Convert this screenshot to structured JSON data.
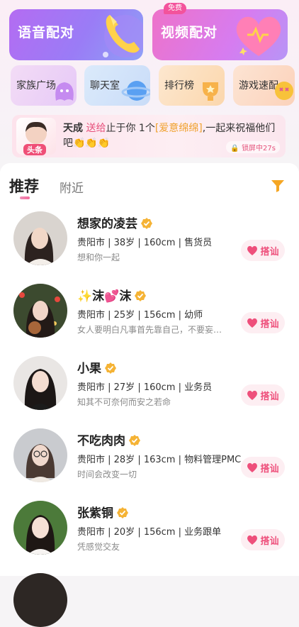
{
  "features": {
    "voice_label": "语音配对",
    "video_label": "视频配对",
    "video_badge": "免费"
  },
  "quick_links": [
    "家族广场",
    "聊天室",
    "排行榜",
    "游戏速配"
  ],
  "gift_banner": {
    "avatar_tag": "头条",
    "sender": "天成",
    "verb": "送给",
    "receiver": "止于你",
    "count": "1个",
    "gift": "[爱意绵绵]",
    "message": ",一起来祝福他们吧",
    "emoji": "👏👏👏",
    "lock_text": "锁屏中27s"
  },
  "tabs": {
    "active": "推荐",
    "inactive": "附近"
  },
  "users": [
    {
      "name": "想家的凌芸",
      "info": "贵阳市 | 38岁 | 160cm | 售货员",
      "bio": "想和你一起",
      "button": "搭讪"
    },
    {
      "name": "✨沫💕沫",
      "info": "贵阳市 | 25岁 | 156cm | 幼师",
      "bio": "女人要明白凡事首先靠自己，不要妄…",
      "button": "搭讪"
    },
    {
      "name": "小果",
      "info": "贵阳市 | 27岁 | 160cm | 业务员",
      "bio": "知其不可奈何而安之若命",
      "button": "搭讪"
    },
    {
      "name": "不吃肉肉",
      "info": "贵阳市 | 28岁 | 163cm | 物料管理PMC",
      "bio": "时间会改变一切",
      "button": "搭讪"
    },
    {
      "name": "张紫铜",
      "info": "贵阳市 | 20岁 | 156cm | 业务跟单",
      "bio": "凭感觉交友",
      "button": "搭讪"
    }
  ],
  "colors": {
    "accent": "#ee4f7b",
    "filter": "#f5a623",
    "verify": "#f5b335"
  }
}
